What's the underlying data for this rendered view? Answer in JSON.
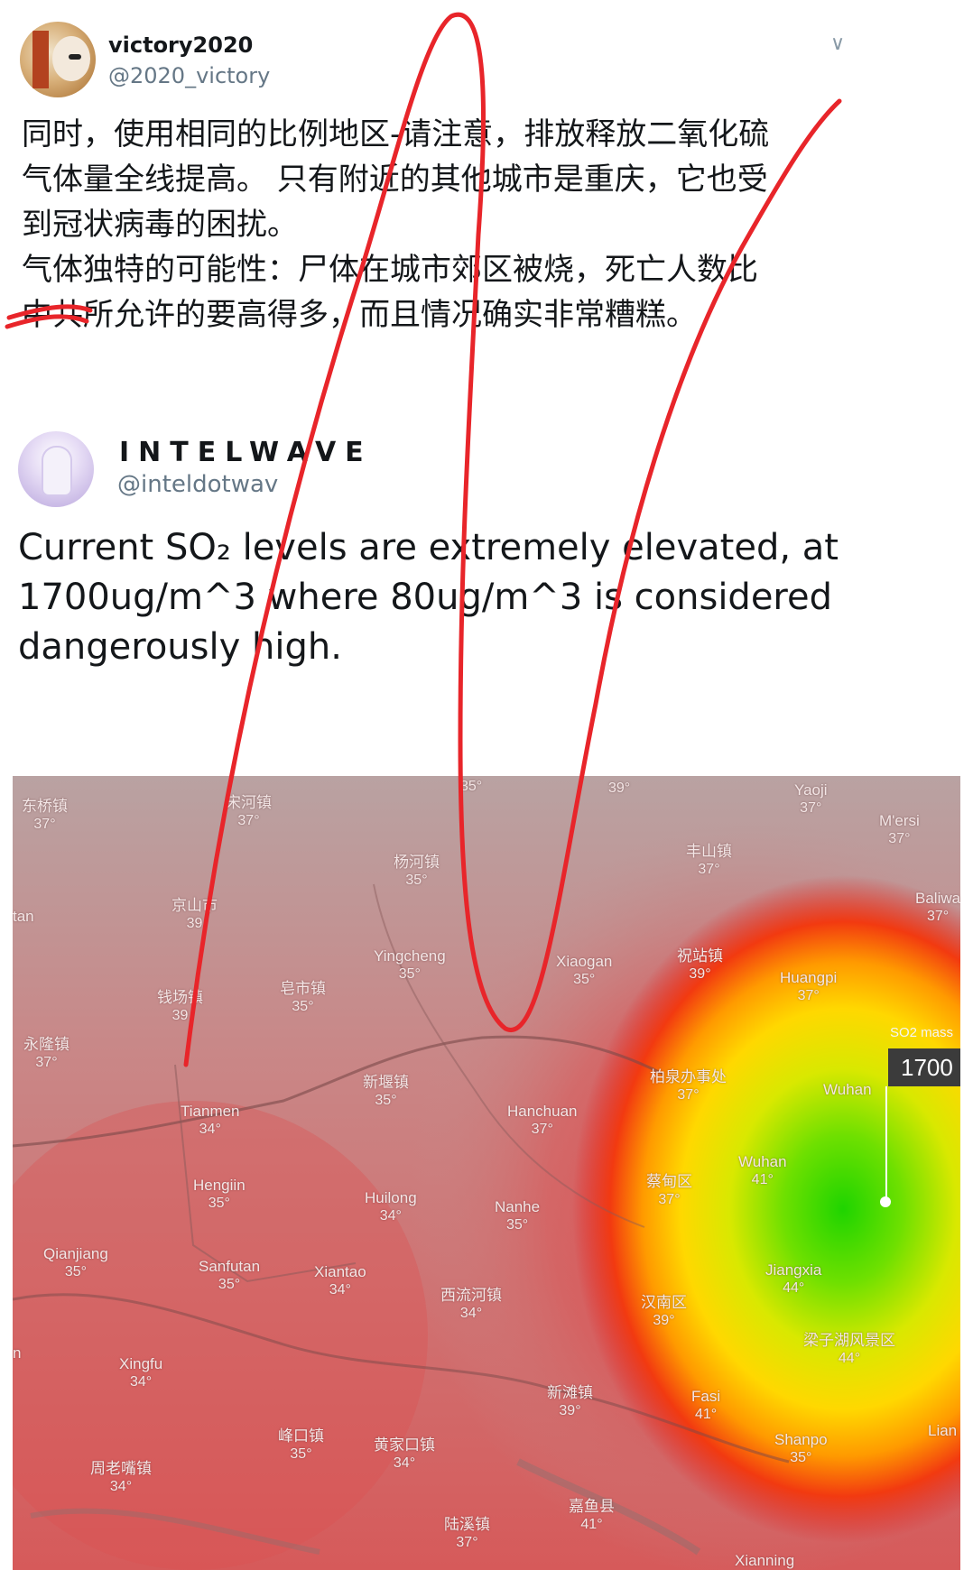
{
  "tweet1": {
    "name": "victory2020",
    "handle": "@2020_victory",
    "text": "同时，使用相同的比例地区-请注意，排放释放二氧化硫\n气体量全线提高。 只有附近的其他城市是重庆，它也受\n到冠状病毒的困扰。\n气体独特的可能性：尸体在城市郊区被烧，死亡人数比\n中共所允许的要高得多，而且情况确实非常糟糕。",
    "menu_icon": "chevron-down-icon"
  },
  "tweet2": {
    "name": "INTELWAVE",
    "handle": "@inteldotwav",
    "text": "Current SO₂ levels are extremely elevated, at 1700ug/m^3 where 80ug/m^3 is considered dangerously high."
  },
  "map": {
    "tooltip_title": "SO2 mass",
    "tooltip_value": "1700",
    "labels": [
      {
        "name": "东桥镇",
        "temp": "37°"
      },
      {
        "name": "宋河镇",
        "temp": "37°"
      },
      {
        "name": "",
        "temp": "35°"
      },
      {
        "name": "",
        "temp": "39°"
      },
      {
        "name": "Yaoji",
        "temp": "37°"
      },
      {
        "name": "M'ersi",
        "temp": "37°"
      },
      {
        "name": "丰山镇",
        "temp": "37°"
      },
      {
        "name": "杨河镇",
        "temp": "35°"
      },
      {
        "name": "Baliwa",
        "temp": "37°"
      },
      {
        "name": "京山市",
        "temp": "39"
      },
      {
        "name": "tan",
        "temp": ""
      },
      {
        "name": "Yingcheng",
        "temp": "35°"
      },
      {
        "name": "Xiaogan",
        "temp": "35°"
      },
      {
        "name": "祝站镇",
        "temp": "39°"
      },
      {
        "name": "Huangpi",
        "temp": "37°"
      },
      {
        "name": "钱场镇",
        "temp": "39"
      },
      {
        "name": "皂市镇",
        "temp": "35°"
      },
      {
        "name": "永隆镇",
        "temp": "37°"
      },
      {
        "name": "新堰镇",
        "temp": "35°"
      },
      {
        "name": "柏泉办事处",
        "temp": "37°"
      },
      {
        "name": "Wuhan",
        "temp": ""
      },
      {
        "name": "Tianmen",
        "temp": "34°"
      },
      {
        "name": "Hanchuan",
        "temp": "37°"
      },
      {
        "name": "Wuhan",
        "temp": "41°"
      },
      {
        "name": "蔡甸区",
        "temp": "37°"
      },
      {
        "name": "Hengiin",
        "temp": "35°"
      },
      {
        "name": "Huilong",
        "temp": "34°"
      },
      {
        "name": "Nanhe",
        "temp": "35°"
      },
      {
        "name": "Jiangxia",
        "temp": "44°"
      },
      {
        "name": "Qianjiang",
        "temp": "35°"
      },
      {
        "name": "Sanfutan",
        "temp": "35°"
      },
      {
        "name": "Xiantao",
        "temp": "34°"
      },
      {
        "name": "西流河镇",
        "temp": "34°"
      },
      {
        "name": "汉南区",
        "temp": "39°"
      },
      {
        "name": "梁子湖风景区",
        "temp": "44°"
      },
      {
        "name": "Xingfu",
        "temp": "34°"
      },
      {
        "name": "新滩镇",
        "temp": "39°"
      },
      {
        "name": "Fasi",
        "temp": "41°"
      },
      {
        "name": "Lian",
        "temp": ""
      },
      {
        "name": "峰口镇",
        "temp": "35°"
      },
      {
        "name": "黄家口镇",
        "temp": "34°"
      },
      {
        "name": "Shanpo",
        "temp": "35°"
      },
      {
        "name": "周老嘴镇",
        "temp": "34°"
      },
      {
        "name": "嘉鱼县",
        "temp": "41°"
      },
      {
        "name": "陆溪镇",
        "temp": "37°"
      },
      {
        "name": "Xianning",
        "temp": ""
      },
      {
        "name": "n",
        "temp": ""
      }
    ]
  }
}
